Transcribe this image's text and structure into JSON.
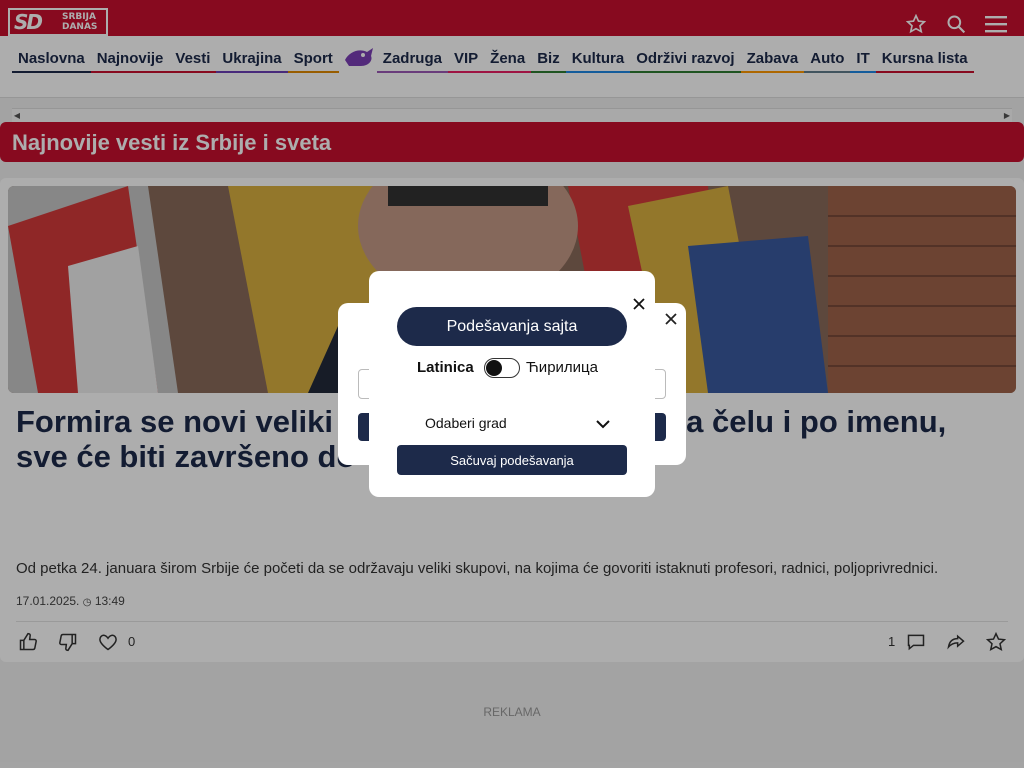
{
  "header": {
    "logo": {
      "mark": "SD",
      "line1": "SRBIJA",
      "line2": "DANAS"
    },
    "icons": [
      "star-icon",
      "search-icon",
      "menu-icon"
    ]
  },
  "nav": {
    "items": [
      {
        "label": "Naslovna",
        "color": "#1d2a4a"
      },
      {
        "label": "Najnovije",
        "color": "#c8102e"
      },
      {
        "label": "Vesti",
        "color": "#c8102e"
      },
      {
        "label": "Ukrajina",
        "color": "#6a3fb5"
      },
      {
        "label": "Sport",
        "color": "#e08a00"
      },
      {
        "label": "Zadruga",
        "color": "#9b59b6"
      },
      {
        "label": "VIP",
        "color": "#e91e63"
      },
      {
        "label": "Žena",
        "color": "#e91e63"
      },
      {
        "label": "Biz",
        "color": "#2e7d32"
      },
      {
        "label": "Kultura",
        "color": "#1e88e5"
      },
      {
        "label": "Održivi razvoj",
        "color": "#2e7d32"
      },
      {
        "label": "Zabava",
        "color": "#ff9800"
      },
      {
        "label": "Auto",
        "color": "#607d8b"
      },
      {
        "label": "IT",
        "color": "#1e88e5"
      },
      {
        "label": "Kursna lista",
        "color": "#c8102e"
      }
    ]
  },
  "section": {
    "title": "Najnovije vesti iz Srbije i sveta"
  },
  "article": {
    "headline": "Formira se novi veliki pokret? Zna se i ko je na čelu i po imenu, sve će biti završeno do Vidovdana",
    "lead": "Od petka 24. januara širom Srbije će početi da se održavaju veliki skupovi, na kojima će govoriti istaknuti profesori, radnici, poljoprivrednici.",
    "date": "17.01.2025.",
    "time": "13:49",
    "likes_count": "0",
    "comments_count": "1"
  },
  "ad": {
    "label": "REKLAMA"
  },
  "modal": {
    "title": "Podešavanja sajta",
    "script_latin": "Latinica",
    "script_cyrillic": "Ћирилица",
    "city_placeholder": "Odaberi grad",
    "save_label": "Sačuvaj podešavanja"
  },
  "colors": {
    "brand": "#c8102e",
    "navy": "#1d2a4a"
  }
}
